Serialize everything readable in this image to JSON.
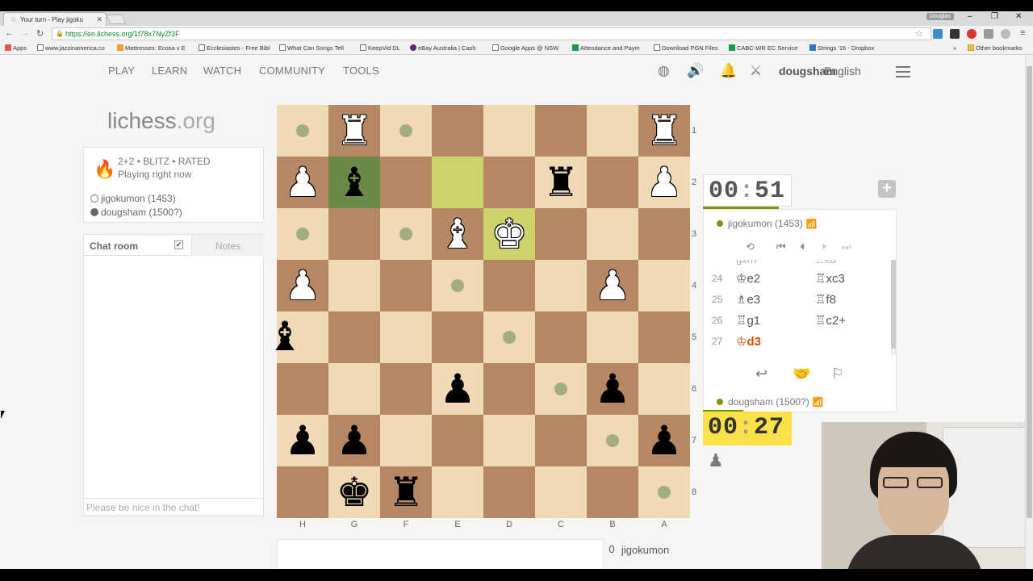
{
  "browser": {
    "tab_title": "Your turn - Play jigoku",
    "profile_name": "Douglas",
    "url": "https://en.lichess.org/1f78x7NyZf3F",
    "bookmarks": [
      "Apps",
      "www.jazzinamerica.co",
      "Mattresses: Ecosa v E",
      "Ecclesiastes - Free Bibl",
      "What Can Songs Tell",
      "KeepVid DL",
      "eBay Australia | Cash",
      "Google Apps @ NSW",
      "Attendance and Paym",
      "Download PGN Files",
      "CABC-WR EC Service",
      "Strings '16 - Dropbox"
    ],
    "other_bookmarks": "Other bookmarks"
  },
  "nav": {
    "play": "PLAY",
    "learn": "LEARN",
    "watch": "WATCH",
    "community": "COMMUNITY",
    "tools": "TOOLS",
    "username": "dougsham",
    "language": "English"
  },
  "logo": {
    "main": "lichess",
    "suffix": ".org"
  },
  "game_info": {
    "mode": "2+2 • BLITZ • RATED",
    "status": "Playing right now",
    "white_player": "jigokumon (1453)",
    "black_player": "dougsham (1500?)"
  },
  "chat": {
    "room_label": "Chat room",
    "notes_label": "Notes",
    "check_mark": "✔",
    "placeholder": "Please be nice in the chat!"
  },
  "board": {
    "files": [
      "H",
      "G",
      "F",
      "E",
      "D",
      "C",
      "B",
      "A"
    ],
    "ranks": [
      "1",
      "2",
      "3",
      "4",
      "5",
      "6",
      "7",
      "8"
    ],
    "pieces": [
      {
        "c": 1,
        "r": 0,
        "g": "♜",
        "w": true
      },
      {
        "c": 7,
        "r": 0,
        "g": "♜",
        "w": true
      },
      {
        "c": 0,
        "r": 1,
        "g": "♟",
        "w": true
      },
      {
        "c": 1,
        "r": 1,
        "g": "♝",
        "w": false
      },
      {
        "c": 5,
        "r": 1,
        "g": "♜",
        "w": false
      },
      {
        "c": 7,
        "r": 1,
        "g": "♟",
        "w": true
      },
      {
        "c": 3,
        "r": 2,
        "g": "♝",
        "w": true
      },
      {
        "c": 4,
        "r": 2,
        "g": "♚",
        "w": true
      },
      {
        "c": 0,
        "r": 3,
        "g": "♟",
        "w": true
      },
      {
        "c": 6,
        "r": 3,
        "g": "♟",
        "w": true
      },
      {
        "c": 3,
        "r": 5,
        "g": "♟",
        "w": false
      },
      {
        "c": 6,
        "r": 5,
        "g": "♟",
        "w": false
      },
      {
        "c": 0,
        "r": 6,
        "g": "♟",
        "w": false
      },
      {
        "c": 1,
        "r": 6,
        "g": "♟",
        "w": false
      },
      {
        "c": 7,
        "r": 6,
        "g": "♟",
        "w": false
      },
      {
        "c": 1,
        "r": 7,
        "g": "♚",
        "w": false
      },
      {
        "c": 2,
        "r": 7,
        "g": "♜",
        "w": false
      }
    ],
    "dragged_piece": "♝",
    "highlight_squares": [
      [
        3,
        1
      ],
      [
        4,
        2
      ]
    ],
    "selected_square": [
      1,
      1
    ],
    "move_dots": [
      [
        0,
        0
      ],
      [
        2,
        0
      ],
      [
        0,
        2
      ],
      [
        2,
        2
      ],
      [
        3,
        3
      ],
      [
        4,
        4
      ],
      [
        5,
        5
      ],
      [
        6,
        6
      ],
      [
        7,
        7
      ]
    ]
  },
  "clock": {
    "top_min": "00",
    "top_sec": "51",
    "bottom_min": "00",
    "bottom_sec": "27",
    "separator": ":"
  },
  "players": {
    "top": "jigokumon (1453)",
    "bottom": "dougsham (1500?)"
  },
  "moves": [
    {
      "n": "24",
      "w": "♔e2",
      "b": "♖xc3"
    },
    {
      "n": "25",
      "w": "♗e3",
      "b": "♖f8"
    },
    {
      "n": "26",
      "w": "♖g1",
      "b": "♖c2+"
    },
    {
      "n": "27",
      "w": "♔d3",
      "b": ""
    }
  ],
  "crosstable": {
    "score": "0",
    "name": "jigokumon"
  }
}
